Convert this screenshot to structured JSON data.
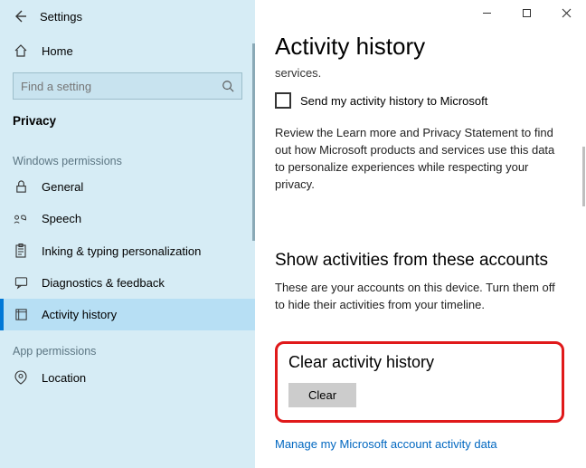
{
  "app_title": "Settings",
  "home_label": "Home",
  "search_placeholder": "Find a setting",
  "current_section": "Privacy",
  "groups": {
    "windows_permissions": "Windows permissions",
    "app_permissions": "App permissions"
  },
  "nav": {
    "general": "General",
    "speech": "Speech",
    "inking": "Inking & typing personalization",
    "diagnostics": "Diagnostics & feedback",
    "activity_history": "Activity history",
    "location": "Location"
  },
  "page": {
    "title": "Activity history",
    "truncated_text": "services.",
    "checkbox_label": "Send my activity history to Microsoft",
    "review_text": "Review the Learn more and Privacy Statement to find out how Microsoft products and services use this data to personalize experiences while respecting your privacy.",
    "accounts_heading": "Show activities from these accounts",
    "accounts_text": "These are your accounts on this device. Turn them off to hide their activities from your timeline.",
    "clear_heading": "Clear activity history",
    "clear_button": "Clear",
    "manage_link": "Manage my Microsoft account activity data"
  }
}
